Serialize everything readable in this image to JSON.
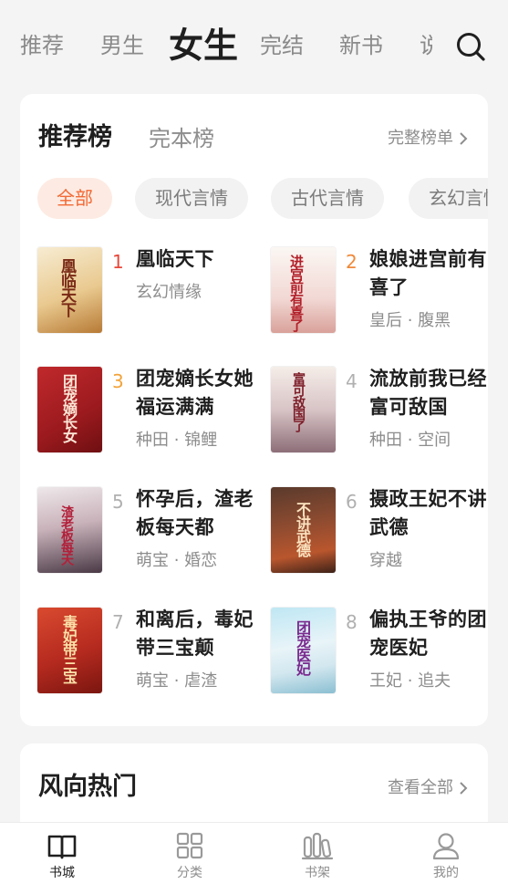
{
  "top_tabs": [
    {
      "label": "推荐"
    },
    {
      "label": "男生"
    },
    {
      "label": "女生",
      "active": true
    },
    {
      "label": "完结"
    },
    {
      "label": "新书"
    },
    {
      "label": "说"
    }
  ],
  "search_icon": "search-icon",
  "rank_card": {
    "title": "推荐榜",
    "tab2": "完本榜",
    "more": "完整榜单",
    "chips": [
      "全部",
      "现代言情",
      "古代言情",
      "玄幻言情"
    ],
    "books": [
      {
        "rank": "1",
        "title": "凰临天下",
        "tags": "玄幻情缘",
        "cover_text": "凰临天下"
      },
      {
        "rank": "2",
        "title": "娘娘进宫前有喜了",
        "tags": "皇后 · 腹黑",
        "cover_text": "进宫前有喜了"
      },
      {
        "rank": "3",
        "title": "团宠嫡长女她福运满满",
        "tags": "种田 · 锦鲤",
        "cover_text": "团宠嫡长女"
      },
      {
        "rank": "4",
        "title": "流放前我已经富可敌国",
        "tags": "种田 · 空间",
        "cover_text": "富可敌国了"
      },
      {
        "rank": "5",
        "title": "怀孕后，渣老板每天都",
        "tags": "萌宝 · 婚恋",
        "cover_text": "渣老板每天"
      },
      {
        "rank": "6",
        "title": "摄政王妃不讲武德",
        "tags": "穿越",
        "cover_text": "不讲武德"
      },
      {
        "rank": "7",
        "title": "和离后，毒妃带三宝颠",
        "tags": "萌宝 · 虐渣",
        "cover_text": "毒妃带三宝"
      },
      {
        "rank": "8",
        "title": "偏执王爷的团宠医妃",
        "tags": "王妃 · 追夫",
        "cover_text": "团宠医妃"
      }
    ]
  },
  "hot_card": {
    "title": "风向热门",
    "more": "查看全部"
  },
  "bottom_nav": [
    {
      "label": "书城",
      "icon": "book-open-icon",
      "active": true
    },
    {
      "label": "分类",
      "icon": "grid-icon"
    },
    {
      "label": "书架",
      "icon": "bookshelf-icon"
    },
    {
      "label": "我的",
      "icon": "user-icon"
    }
  ],
  "colors": {
    "accent": "#f26a35",
    "rank_top": "#e8483b",
    "rank_second": "#f0893a",
    "rank_third": "#f2a33a",
    "rank_other": "#b0b0b0"
  }
}
